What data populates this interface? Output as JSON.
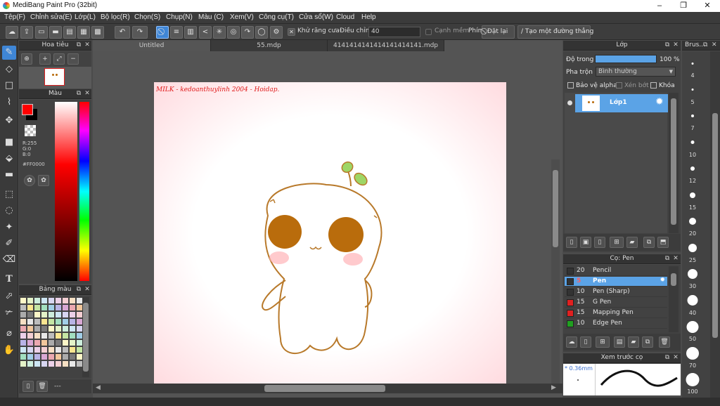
{
  "window": {
    "title": "MediBang Paint Pro (32bit)",
    "controls": [
      "–",
      "❐",
      "✕"
    ]
  },
  "menu": [
    "Tệp(F)",
    "Chỉnh sửa(E)",
    "Lớp(L)",
    "Bộ lọc(R)",
    "Chọn(S)",
    "Chụp(N)",
    "Màu (C)",
    "Xem(V)",
    "Công cụ(T)",
    "Cửa sổ(W)",
    "Cloud",
    "Help"
  ],
  "toolbar": {
    "antialias_label": "Khử răng cưa",
    "correction_label": "Điều chỉnh",
    "correction_value": "40",
    "edge_label": "Cạnh mềm",
    "key_label": "Phím",
    "reset_label": "Đặt lại",
    "create_line_label": "Tạo một đường thẳng"
  },
  "navigator": {
    "title": "Hoa tiêu"
  },
  "color_panel": {
    "title": "Màu",
    "r": "R:255",
    "g": "G:0",
    "b": "B:0",
    "hex": "#FF0000",
    "fg_color": "#ff0000",
    "bg_color": "#000000"
  },
  "palette": {
    "title": "Bảng màu",
    "footer_text": "---"
  },
  "tabs": [
    "Untitled",
    "55.mdp",
    "4141414141414141414141.mdp"
  ],
  "canvas": {
    "signature": "MILK - kedoanthuylinh 2004 - Hoidap."
  },
  "layer_panel": {
    "title": "Lớp",
    "opacity_label": "Độ trong",
    "opacity_value": "100 %",
    "blend_label": "Pha trộn",
    "blend_value": "Bình thường",
    "protect_alpha": "Bảo vệ alpha",
    "clipping": "Xén bớt",
    "lock": "Khóa",
    "layer_name": "Lớp1"
  },
  "brush_panel": {
    "title": "Cọ: Pen",
    "brushes": [
      {
        "size": "20",
        "name": "Pencil",
        "color": "#333333"
      },
      {
        "size": "5",
        "name": "Pen",
        "color": "#333333",
        "selected": true
      },
      {
        "size": "10",
        "name": "Pen (Sharp)",
        "color": "#333333"
      },
      {
        "size": "15",
        "name": "G Pen",
        "color": "#e02020"
      },
      {
        "size": "15",
        "name": "Mapping Pen",
        "color": "#e02020"
      },
      {
        "size": "10",
        "name": "Edge Pen",
        "color": "#20a020"
      }
    ]
  },
  "preview_panel": {
    "title": "Xem trước cọ",
    "size_text": "* 0.36mm"
  },
  "brush_size_panel": {
    "title": "Brus...",
    "sizes": [
      "4",
      "5",
      "7",
      "10",
      "12",
      "15",
      "20",
      "25",
      "30",
      "40",
      "50",
      "70",
      "100"
    ]
  }
}
